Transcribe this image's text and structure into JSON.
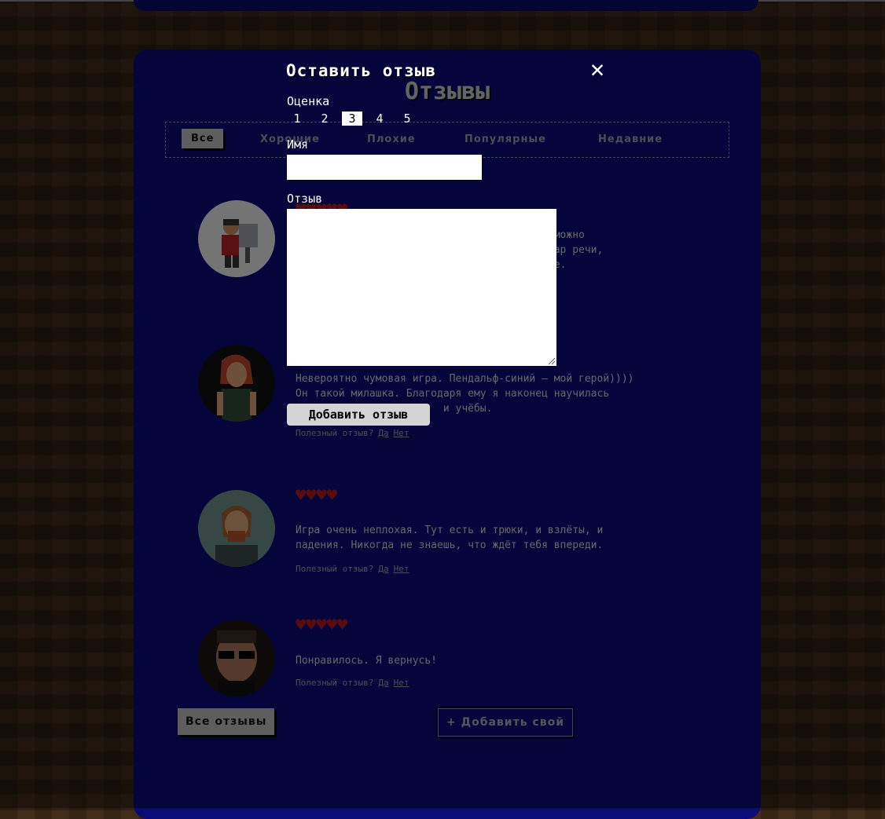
{
  "page": {
    "reviews_title": "Отзывы",
    "filters": [
      "Все",
      "Хорошие",
      "Плохие",
      "Популярные",
      "Недавние"
    ],
    "active_filter": "Все",
    "reviews": [
      {
        "hearts": 5,
        "text": "                                     невозможно\n                                   шку и дар речи,\n                                    спасите.",
        "useful_label": "",
        "yes": "",
        "no": ""
      },
      {
        "hearts": 0,
        "text": "Невероятно чумовая игра. Пендальф-синий — мой герой))))\nОн такой милашка. Благодаря ему я наконец научилась\n                        и учёбы.",
        "useful_label": "Полезный отзыв?",
        "yes": "Да",
        "no": "Нет"
      },
      {
        "hearts": 4,
        "text": "Игра очень неплохая. Тут есть и трюки, и взлёты, и\nпадения. Никогда не знаешь, что ждёт тебя впереди.",
        "useful_label": "Полезный отзыв?",
        "yes": "Да",
        "no": "Нет"
      },
      {
        "hearts": 5,
        "text": "Понравилось. Я вернусь!",
        "useful_label": "Полезный отзыв?",
        "yes": "Да",
        "no": "Нет"
      }
    ],
    "all_reviews_button": "Все отзывы",
    "add_own_button": "+ Добавить свой"
  },
  "modal": {
    "title": "Оставить отзыв",
    "close_icon": "close-icon",
    "rating_label": "Оценка",
    "rating_options": [
      "1",
      "2",
      "3",
      "4",
      "5"
    ],
    "rating_selected": "3",
    "name_label": "Имя",
    "name_value": "",
    "review_label": "Отзыв",
    "review_value": "",
    "submit_label": "Добавить отзыв"
  },
  "colors": {
    "panel": "#0b0b78",
    "heart": "#b01818",
    "overlay": "rgba(0,0,0,0.5)"
  }
}
